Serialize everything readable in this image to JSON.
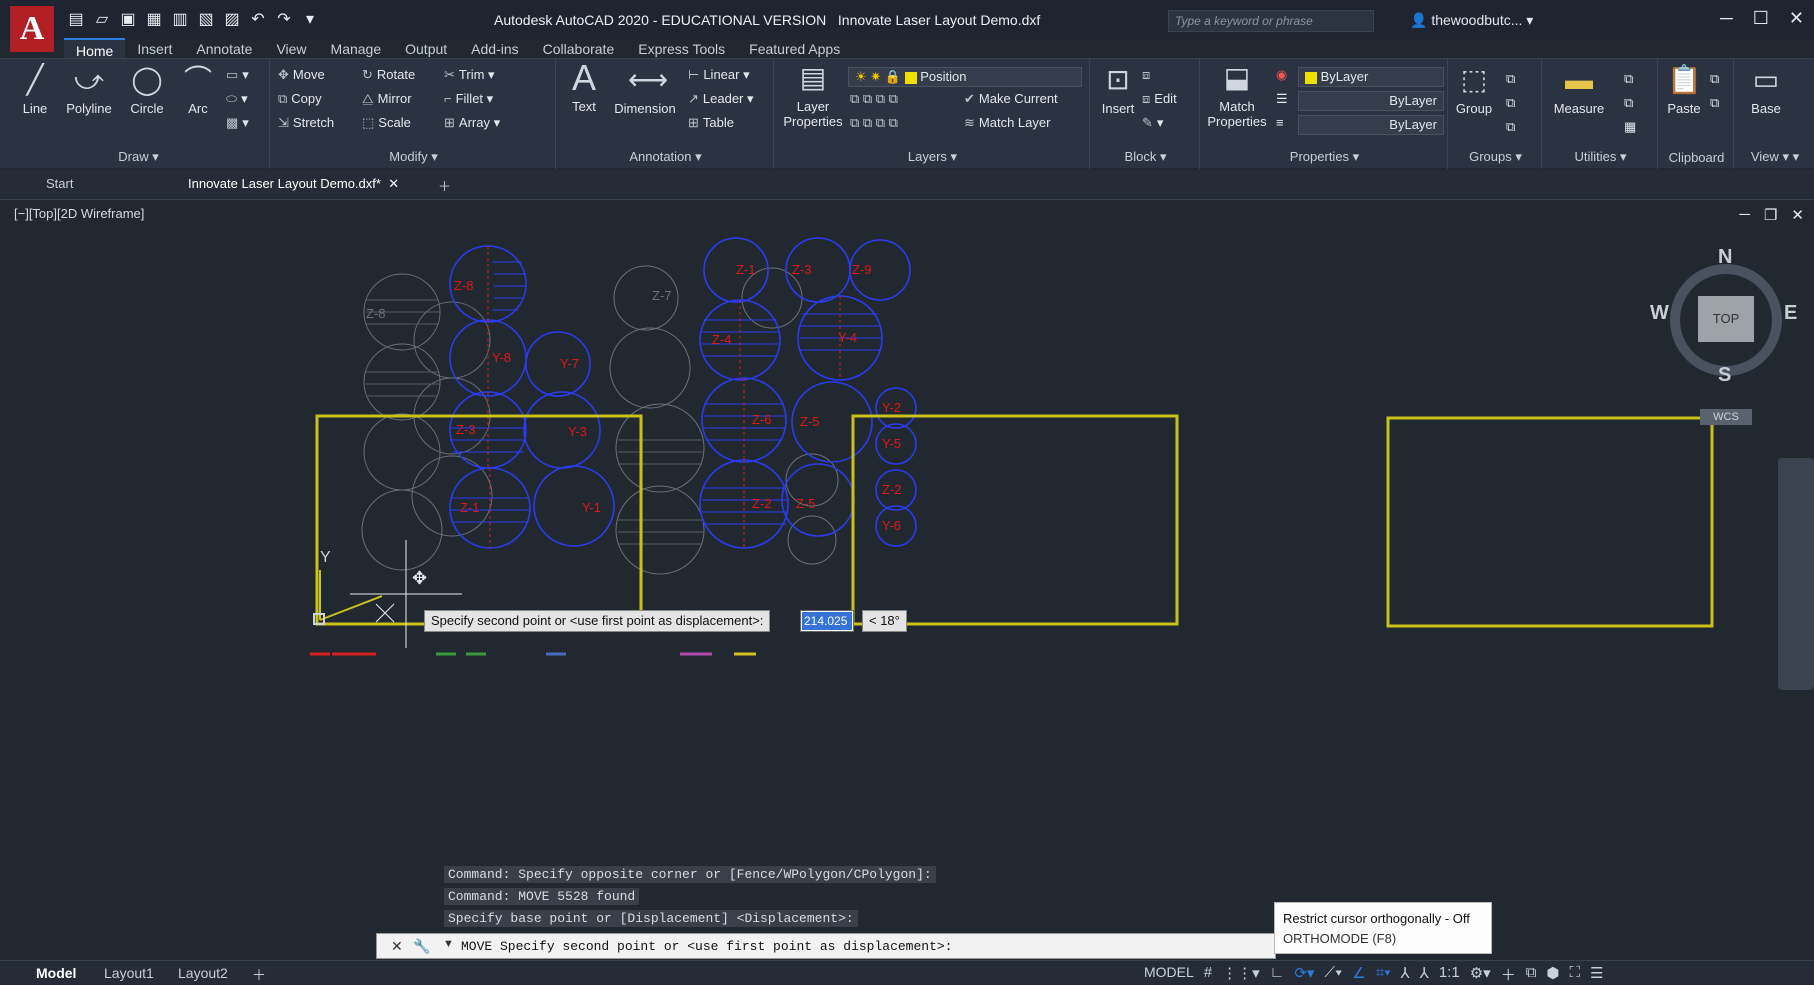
{
  "title": {
    "app_title": "Autodesk AutoCAD 2020 - EDUCATIONAL VERSION",
    "document": "Innovate Laser Layout Demo.dxf",
    "search_placeholder": "Type a keyword or phrase",
    "user": "thewoodbutc..."
  },
  "ribbon_tabs": [
    "Home",
    "Insert",
    "Annotate",
    "View",
    "Manage",
    "Output",
    "Add-ins",
    "Collaborate",
    "Express Tools",
    "Featured Apps"
  ],
  "ribbon": {
    "draw": {
      "title": "Draw",
      "line": "Line",
      "polyline": "Polyline",
      "circle": "Circle",
      "arc": "Arc"
    },
    "modify": {
      "title": "Modify",
      "move": "Move",
      "rotate": "Rotate",
      "trim": "Trim",
      "copy": "Copy",
      "mirror": "Mirror",
      "fillet": "Fillet",
      "stretch": "Stretch",
      "scale": "Scale",
      "array": "Array"
    },
    "annotation": {
      "title": "Annotation",
      "text": "Text",
      "dimension": "Dimension",
      "linear": "Linear",
      "leader": "Leader",
      "table": "Table"
    },
    "layers": {
      "title": "Layers",
      "layer_properties": "Layer Properties",
      "current_layer": "Position",
      "make_current": "Make Current",
      "match_layer": "Match Layer"
    },
    "block": {
      "title": "Block",
      "insert": "Insert",
      "edit": "Edit"
    },
    "properties": {
      "title": "Properties",
      "match_properties": "Match Properties",
      "color": "ByLayer",
      "linetype": "ByLayer",
      "lineweight": "ByLayer"
    },
    "groups": {
      "title": "Groups",
      "group": "Group"
    },
    "utilities": {
      "title": "Utilities",
      "measure": "Measure"
    },
    "clipboard": {
      "title": "Clipboard",
      "paste": "Paste"
    },
    "view": {
      "title": "View",
      "base": "Base"
    }
  },
  "doc_tabs": {
    "start": "Start",
    "active": "Innovate Laser Layout Demo.dxf*"
  },
  "viewport": {
    "label": "[−][Top][2D Wireframe]",
    "viewcube": {
      "n": "N",
      "s": "S",
      "e": "E",
      "w": "W",
      "top": "TOP",
      "wcs": "WCS"
    },
    "ucs_y": "Y"
  },
  "circle_labels": [
    "Z-8",
    "Z-8",
    "Y-8",
    "Y-7",
    "Z-3",
    "Y-3",
    "Z-1",
    "Y-1",
    "Z-1",
    "Z-3",
    "Z-9",
    "Z-4",
    "Y-4",
    "Z-6",
    "Z-5",
    "Y-2",
    "Y-5",
    "Z-5",
    "Z-2",
    "Y-6",
    "Z-2",
    "Z-7"
  ],
  "dynamic_input": {
    "prompt": "Specify second point or <use first point as displacement>:",
    "value": "214.025",
    "angle": "< 18°"
  },
  "command_history": [
    "Command: Specify opposite corner or [Fence/WPolygon/CPolygon]:",
    "Command: MOVE 5528 found",
    "Specify base point or [Displacement] <Displacement>:"
  ],
  "command_line": "MOVE Specify second point or <use first point as displacement>:",
  "tooltip": {
    "title": "Restrict cursor orthogonally - Off",
    "sub": "ORTHOMODE (F8)"
  },
  "status": {
    "model": "Model",
    "layout1": "Layout1",
    "layout2": "Layout2",
    "space": "MODEL",
    "scale": "1:1"
  }
}
